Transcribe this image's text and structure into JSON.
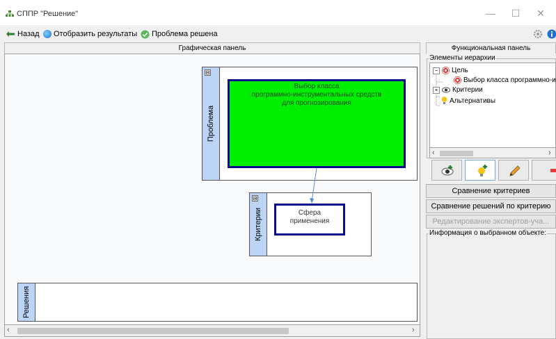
{
  "window": {
    "title": "СППР \"Решение\"",
    "minimize": "—",
    "maximize": "☐",
    "close": "✕"
  },
  "toolbar": {
    "back_label": "Назад",
    "show_results_label": "Отобразить результаты",
    "problem_solved_label": "Проблема решена"
  },
  "graphic_panel": {
    "title": "Графическая панель",
    "lanes": {
      "problem": "Проблема",
      "criteria": "Критерии",
      "solutions": "Решения"
    },
    "goal_node": [
      "Выбор класса",
      "программно-инструментальных средств",
      "для прогнозирования"
    ],
    "criterion_node": [
      "Сфера",
      "применения"
    ],
    "collapse_symbol": "⊟"
  },
  "functional_panel": {
    "title": "Функциональная панель",
    "hierarchy_legend": "Элементы иерархии",
    "tree": {
      "goal": "Цель",
      "goal_child": "Выбор класса программно-и",
      "criteria": "Критерии",
      "alternatives": "Альтернативы",
      "expanded": "−",
      "collapsed": "+"
    },
    "buttons": {
      "compare_criteria": "Сравнение критериев",
      "compare_solutions": "Сравнение решений по критерию",
      "edit_experts": "Редактирование экспертов-уча..."
    },
    "info_legend": "Информация о выбранном объекте:"
  },
  "colors": {
    "goal_fill": "#00ee00",
    "node_border": "#0a0a8c",
    "lane_label": "#bcd4f6",
    "arrow": "#5b8fd6"
  },
  "icons": [
    "app-icon",
    "back-arrow-icon",
    "globe-icon",
    "check-icon",
    "gear-icon",
    "info-icon",
    "target-icon",
    "eye-icon",
    "bulb-icon",
    "add-eye-icon",
    "add-bulb-icon",
    "pencil-icon",
    "delete-icon"
  ]
}
